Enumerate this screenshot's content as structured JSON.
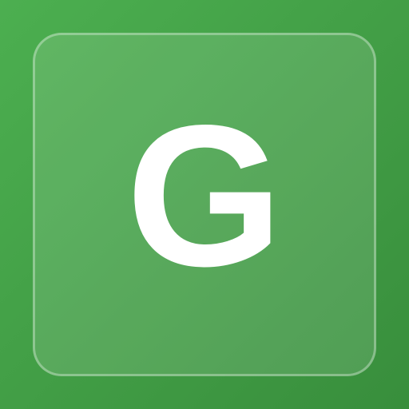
{
  "icon": {
    "letter": "G",
    "background_color": "#43a047",
    "letter_color": "#ffffff"
  }
}
